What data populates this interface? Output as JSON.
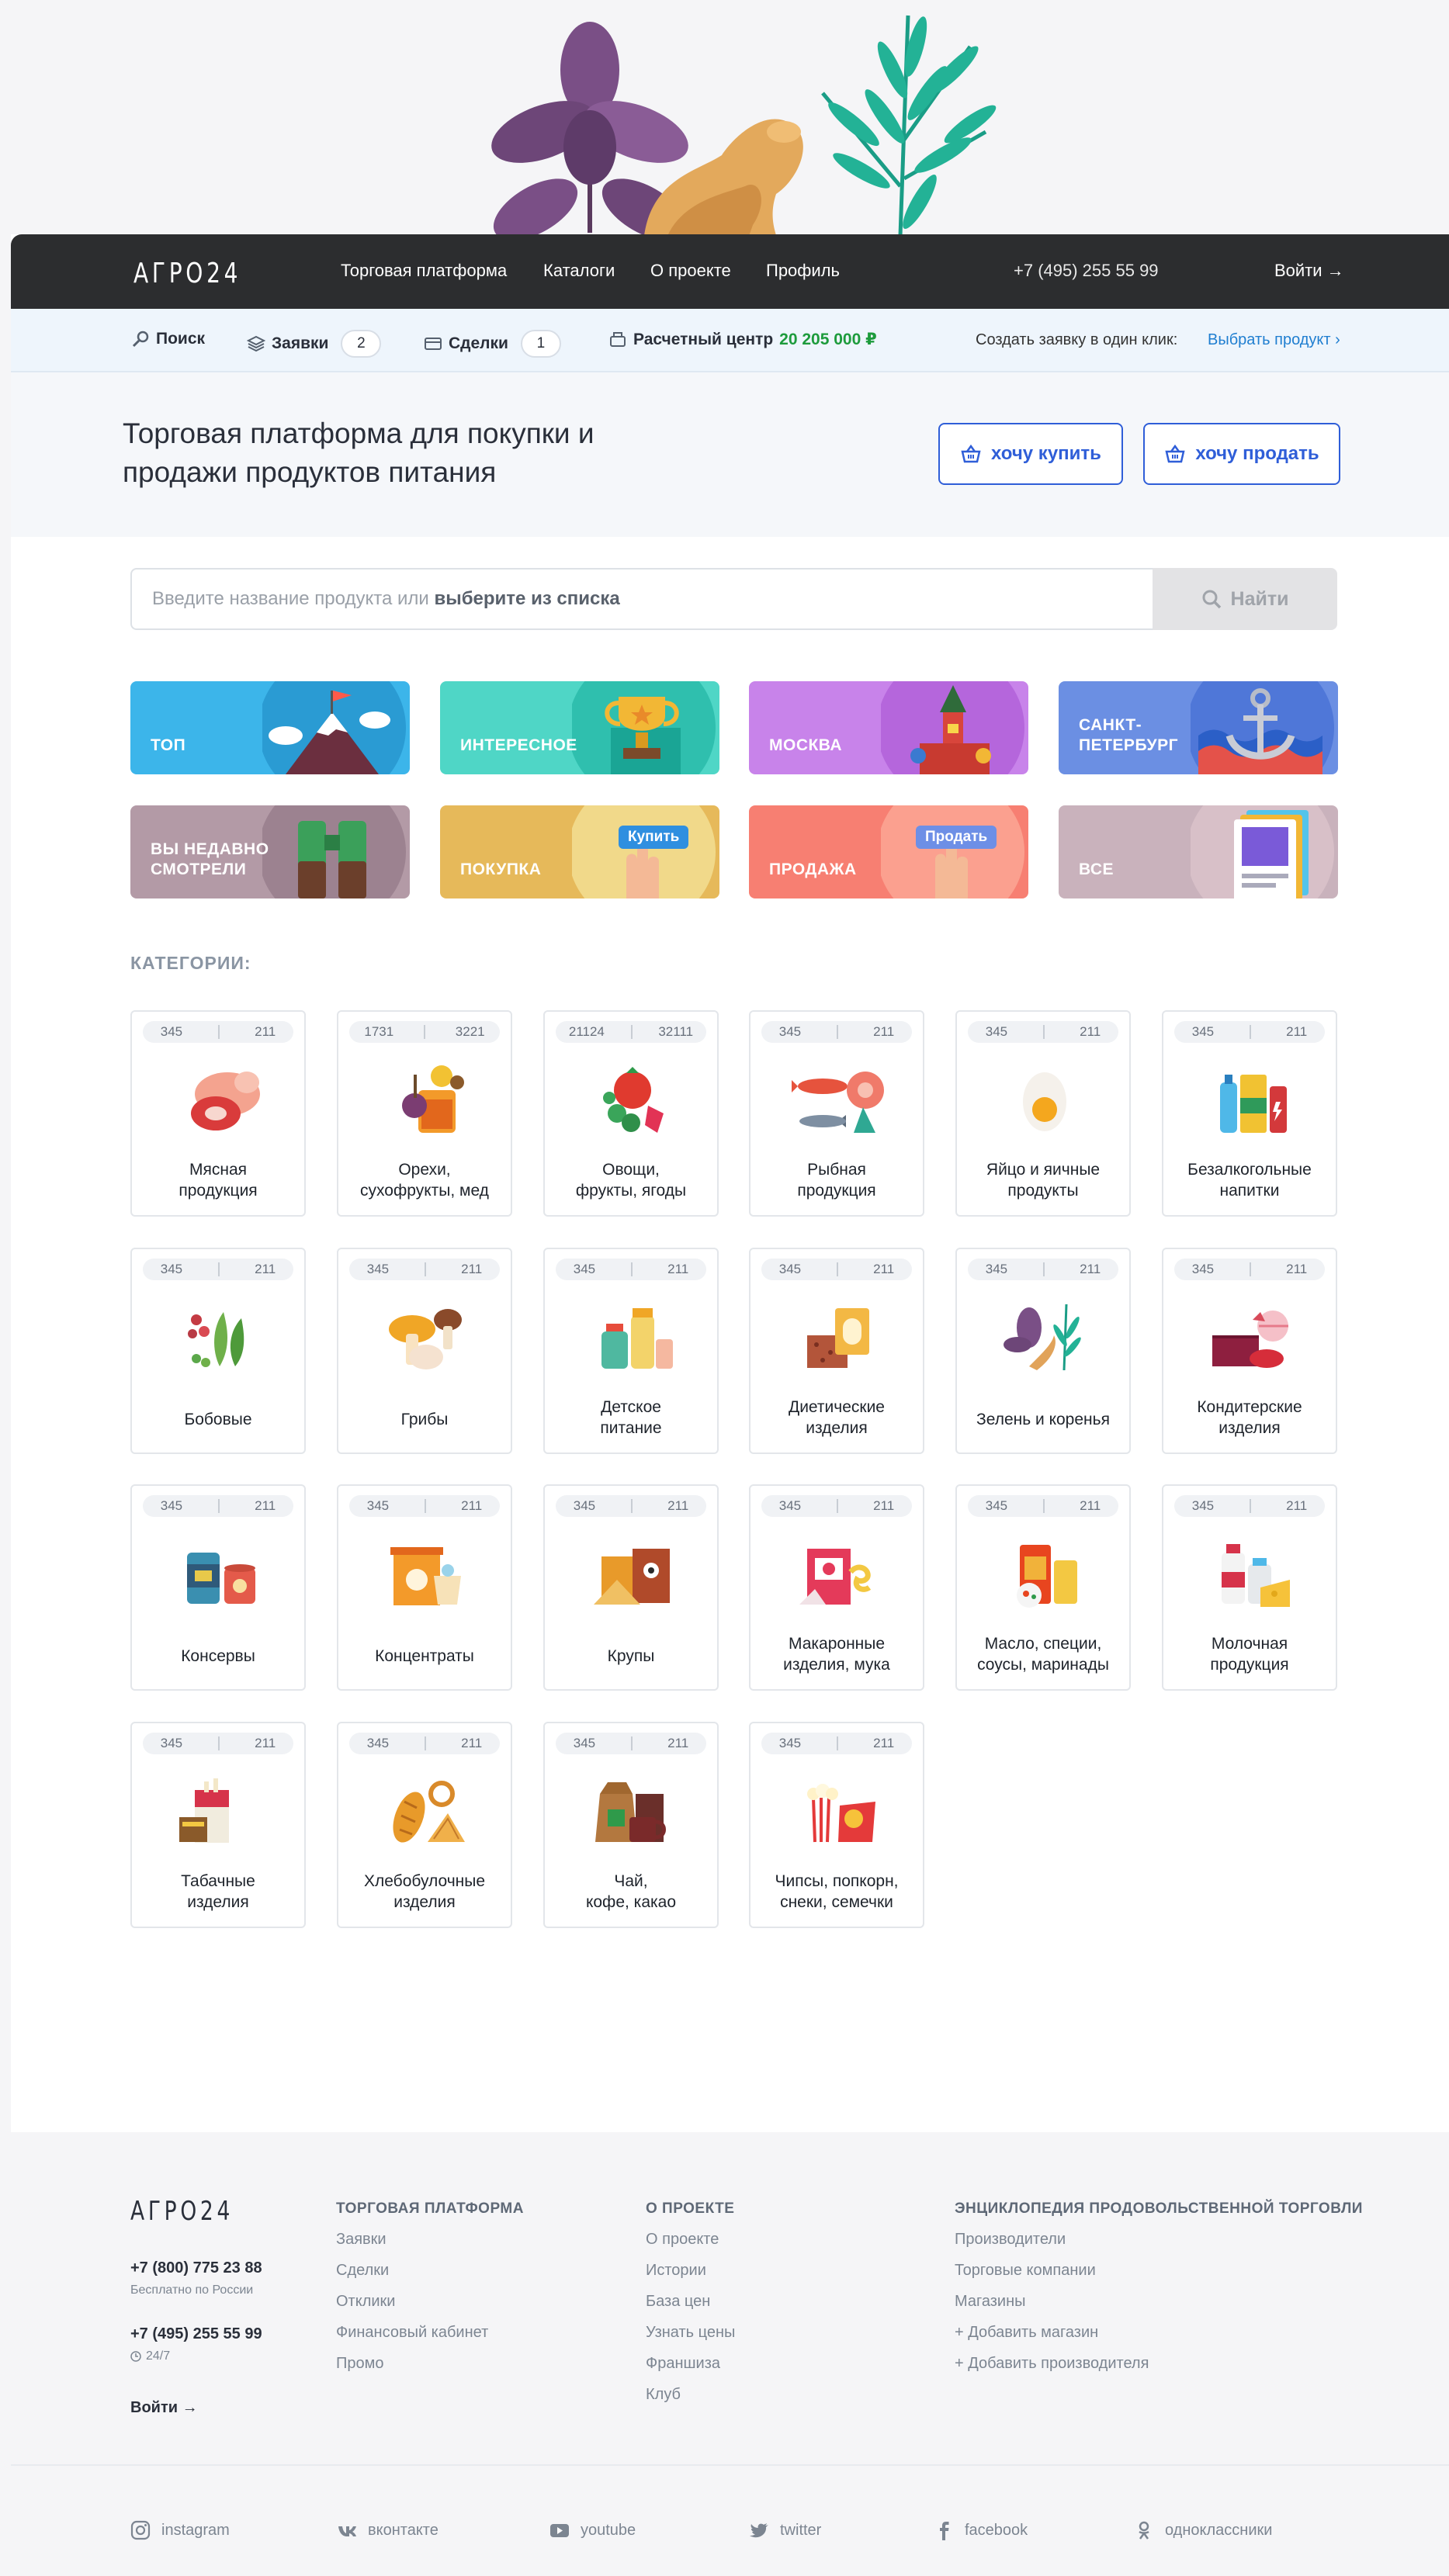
{
  "header": {
    "logo": "АГРО24",
    "nav": [
      "Торговая платформа",
      "Каталоги",
      "О проекте",
      "Профиль"
    ],
    "phone": "+7 (495) 255 55 99",
    "login": "Войти →"
  },
  "subnav": {
    "search": "Поиск",
    "requests_label": "Заявки",
    "requests_count": "2",
    "deals_label": "Сделки",
    "deals_count": "1",
    "settlement_label": "Расчетный центр",
    "settlement_amount": "20 205 000 ₽",
    "oneclick_text": "Создать заявку в один клик:",
    "oneclick_link": "Выбрать продукт"
  },
  "hero": {
    "headline": "Торговая платформа для покупки и продажи продуктов питания",
    "buy": "хочу купить",
    "sell": "хочу продать"
  },
  "search": {
    "placeholder_prefix": "Введите название продукта или ",
    "placeholder_link": "выберите из списка",
    "button": "Найти"
  },
  "quick_tiles": [
    {
      "label": "ТОП",
      "color": "#3cb5ea"
    },
    {
      "label": "ИНТЕРЕСНОЕ",
      "color": "#4fd6c6"
    },
    {
      "label": "МОСКВА",
      "color": "#c883ea"
    },
    {
      "label": "САНКТ-\nПЕТЕРБУРГ",
      "color": "#6b8fe3"
    },
    {
      "label": "ВЫ НЕДАВНО\nСМОТРЕЛИ",
      "color": "#b39aa6"
    },
    {
      "label": "ПОКУПКА",
      "color": "#e6b95a",
      "badge": "Купить"
    },
    {
      "label": "ПРОДАЖА",
      "color": "#f77f72",
      "badge": "Продать"
    },
    {
      "label": "ВСЕ",
      "color": "#c9b2bc"
    }
  ],
  "categories_title": "КАТЕГОРИИ:",
  "categories": [
    {
      "title": "Мясная\nпродукция",
      "a": "345",
      "b": "211",
      "icon": "meat-icon"
    },
    {
      "title": "Орехи,\nсухофрукты, мед",
      "a": "1731",
      "b": "3221",
      "icon": "nuts-honey-icon"
    },
    {
      "title": "Овощи,\nфрукты, ягоды",
      "a": "21124",
      "b": "32111",
      "icon": "vegetables-icon"
    },
    {
      "title": "Рыбная\nпродукция",
      "a": "345",
      "b": "211",
      "icon": "fish-icon"
    },
    {
      "title": "Яйцо и яичные\nпродукты",
      "a": "345",
      "b": "211",
      "icon": "egg-icon"
    },
    {
      "title": "Безалкогольные\nнапитки",
      "a": "345",
      "b": "211",
      "icon": "drinks-icon"
    },
    {
      "title": "Бобовые",
      "a": "345",
      "b": "211",
      "icon": "legumes-icon"
    },
    {
      "title": "Грибы",
      "a": "345",
      "b": "211",
      "icon": "mushrooms-icon"
    },
    {
      "title": "Детское\nпитание",
      "a": "345",
      "b": "211",
      "icon": "baby-food-icon"
    },
    {
      "title": "Диетические\nизделия",
      "a": "345",
      "b": "211",
      "icon": "diet-icon"
    },
    {
      "title": "Зелень и коренья",
      "a": "345",
      "b": "211",
      "icon": "herbs-icon"
    },
    {
      "title": "Кондитерские\nизделия",
      "a": "345",
      "b": "211",
      "icon": "confectionery-icon"
    },
    {
      "title": "Консервы",
      "a": "345",
      "b": "211",
      "icon": "canned-icon"
    },
    {
      "title": "Концентраты",
      "a": "345",
      "b": "211",
      "icon": "concentrates-icon"
    },
    {
      "title": "Крупы",
      "a": "345",
      "b": "211",
      "icon": "grains-icon"
    },
    {
      "title": "Макаронные\nизделия, мука",
      "a": "345",
      "b": "211",
      "icon": "pasta-icon"
    },
    {
      "title": "Масло, специи,\nсоусы, маринады",
      "a": "345",
      "b": "211",
      "icon": "oil-spices-icon"
    },
    {
      "title": "Молочная\nпродукция",
      "a": "345",
      "b": "211",
      "icon": "dairy-icon"
    },
    {
      "title": "Табачные\nизделия",
      "a": "345",
      "b": "211",
      "icon": "tobacco-icon"
    },
    {
      "title": "Хлебобулочные\nизделия",
      "a": "345",
      "b": "211",
      "icon": "bakery-icon"
    },
    {
      "title": "Чай,\nкофе, какао",
      "a": "345",
      "b": "211",
      "icon": "tea-coffee-icon"
    },
    {
      "title": "Чипсы, попкорн,\nснеки, семечки",
      "a": "345",
      "b": "211",
      "icon": "snacks-icon"
    }
  ],
  "footer": {
    "logo": "АГРО24",
    "phone1": "+7 (800) 775 23 88",
    "phone1_note": "Бесплатно по России",
    "phone2": "+7 (495) 255 55 99",
    "phone2_note": "24/7",
    "login": "Войти →",
    "columns": [
      {
        "title": "ТОРГОВАЯ ПЛАТФОРМА",
        "links": [
          "Заявки",
          "Сделки",
          "Отклики",
          "Финансовый кабинет",
          "Промо"
        ]
      },
      {
        "title": "О ПРОЕКТЕ",
        "links": [
          "О проекте",
          "Истории",
          "База цен",
          "Узнать цены",
          "Франшиза",
          "Клуб"
        ]
      },
      {
        "title": "ЭНЦИКЛОПЕДИЯ ПРОДОВОЛЬСТВЕННОЙ ТОРГОВЛИ",
        "links": [
          "Производители",
          "Торговые компании",
          "Магазины",
          "+ Добавить магазин",
          "+ Добавить производителя"
        ]
      }
    ],
    "social": [
      "instagram",
      "вконтакте",
      "youtube",
      "twitter",
      "facebook",
      "одноклассники"
    ]
  }
}
